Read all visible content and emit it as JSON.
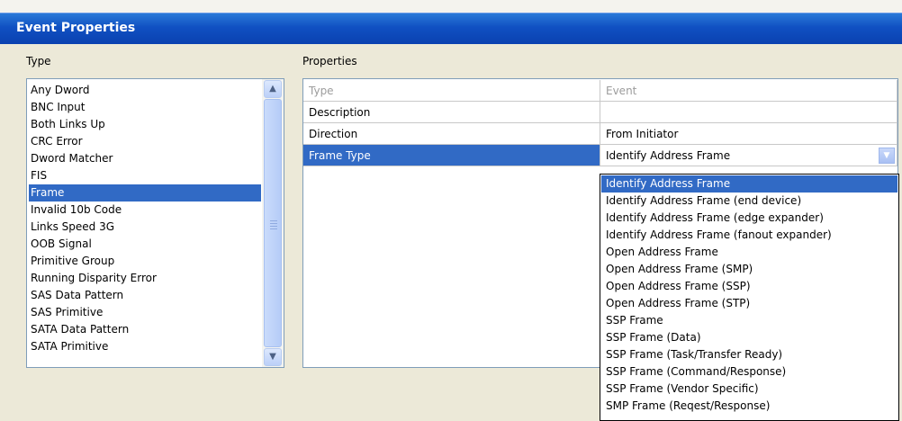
{
  "window": {
    "title": "Event Properties"
  },
  "type_panel": {
    "label": "Type",
    "items": [
      "Any Dword",
      "BNC Input",
      "Both Links Up",
      "CRC Error",
      "Dword Matcher",
      "FIS",
      "Frame",
      "Invalid 10b Code",
      "Links Speed 3G",
      "OOB Signal",
      "Primitive Group",
      "Running Disparity Error",
      "SAS Data Pattern",
      "SAS Primitive",
      "SATA Data Pattern",
      "SATA Primitive"
    ],
    "selected": "Frame"
  },
  "properties_panel": {
    "label": "Properties",
    "rows": [
      {
        "name": "Type",
        "value": "Event"
      },
      {
        "name": "Description",
        "value": ""
      },
      {
        "name": "Direction",
        "value": "From Initiator"
      },
      {
        "name": "Frame Type",
        "value": "Identify Address Frame"
      }
    ]
  },
  "frame_type_dropdown": {
    "selected": "Identify Address Frame",
    "options": [
      "Identify Address Frame",
      "Identify Address Frame (end device)",
      "Identify Address Frame (edge expander)",
      "Identify Address Frame (fanout expander)",
      "Open Address Frame",
      "Open Address Frame (SMP)",
      "Open Address Frame (SSP)",
      "Open Address Frame (STP)",
      "SSP Frame",
      "SSP Frame (Data)",
      "SSP Frame (Task/Transfer Ready)",
      "SSP Frame (Command/Response)",
      "SSP Frame (Vendor Specific)",
      "SMP Frame (Reqest/Response)"
    ]
  },
  "icons": {
    "scroll_up": "▲",
    "scroll_down": "▼",
    "dropdown": "▼"
  }
}
